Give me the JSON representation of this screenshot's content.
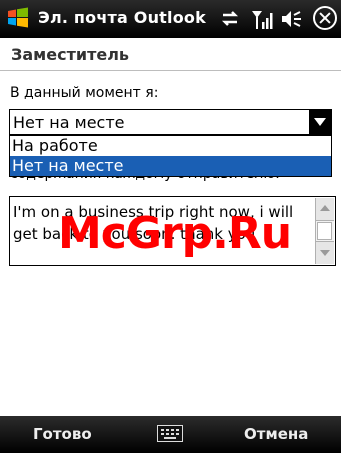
{
  "status_bar": {
    "app_title": "Эл. почта Outlook",
    "icons": [
      "windows-logo-icon",
      "data-connection-icon",
      "signal-icon",
      "speaker-icon",
      "close-icon"
    ]
  },
  "header": {
    "title": "Заместитель"
  },
  "form": {
    "status_label": "В данный момент я:",
    "combo_value": "Нет на месте",
    "dropdown_options": [
      "На работе",
      "Нет на месте"
    ],
    "selected_option_index": 1,
    "hidden_label_fragment": "содержания каждому отправителю:",
    "reply_text": "I'm on a business trip right now, i will get back to you soon. thank you"
  },
  "watermark": "McGrp.Ru",
  "softkeys": {
    "left": "Готово",
    "right": "Отмена"
  },
  "colors": {
    "selection": "#1a5fb4",
    "watermark": "#ff0000",
    "bars": "#000000"
  }
}
